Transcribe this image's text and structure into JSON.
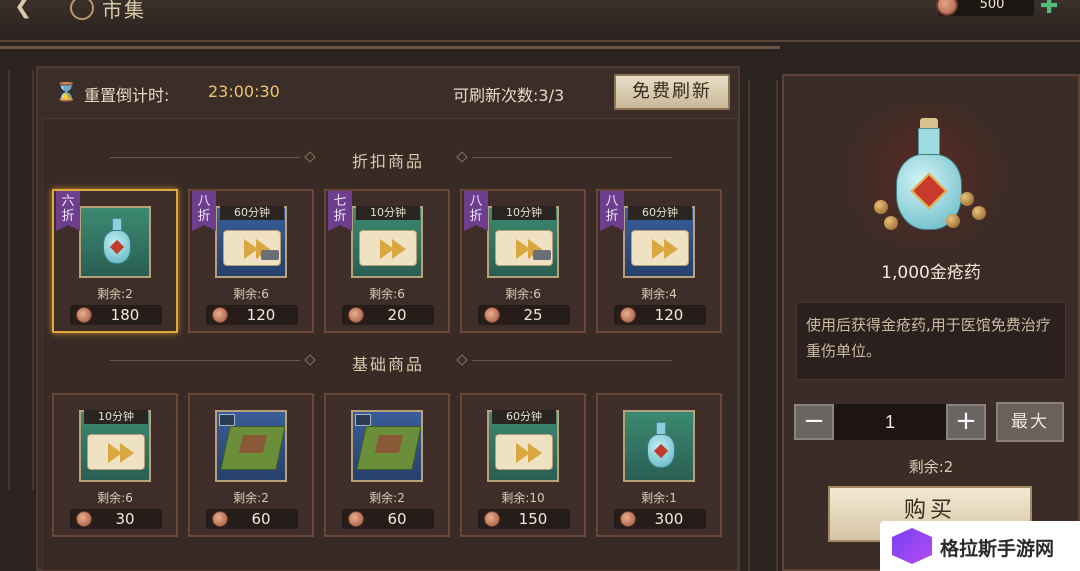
{
  "header": {
    "title": "市集",
    "coin_amount": "500"
  },
  "shop": {
    "timer_label": "重置倒计时:",
    "timer_value": "23:00:30",
    "refresh_label": "可刷新次数:3/3",
    "refresh_button": "免费刷新"
  },
  "sections": {
    "discount_title": "折扣商品",
    "basic_title": "基础商品"
  },
  "discount_items": [
    {
      "discount": "六折",
      "timer": "",
      "icon": "bottle-icon",
      "stock": "剩余:2",
      "price": "180"
    },
    {
      "discount": "八折",
      "timer": "60分钟",
      "icon": "scroll-hammer-icon",
      "stock": "剩余:6",
      "price": "120"
    },
    {
      "discount": "七折",
      "timer": "10分钟",
      "icon": "scroll-icon",
      "stock": "剩余:6",
      "price": "20"
    },
    {
      "discount": "八折",
      "timer": "10分钟",
      "icon": "scroll-hammer-icon",
      "stock": "剩余:6",
      "price": "25"
    },
    {
      "discount": "八折",
      "timer": "60分钟",
      "icon": "scroll-icon",
      "stock": "剩余:4",
      "price": "120"
    }
  ],
  "basic_items": [
    {
      "timer": "10分钟",
      "icon": "scroll-icon",
      "stock": "剩余:6",
      "price": "30"
    },
    {
      "timer": "",
      "icon": "land-tile-icon",
      "stock": "剩余:2",
      "price": "60"
    },
    {
      "timer": "",
      "icon": "farm-tile-icon",
      "stock": "剩余:2",
      "price": "60"
    },
    {
      "timer": "60分钟",
      "icon": "scroll-icon",
      "stock": "剩余:10",
      "price": "150"
    },
    {
      "timer": "",
      "icon": "bottle-icon",
      "stock": "剩余:1",
      "price": "300"
    }
  ],
  "detail": {
    "item_name": "1,000金疮药",
    "description": "使用后获得金疮药,用于医馆免费治疗重伤单位。",
    "quantity": "1",
    "minus": "−",
    "plus": "+",
    "max_button": "最大",
    "stock": "剩余:2",
    "buy_button": "购买"
  },
  "watermark": "格拉斯手游网",
  "colors": {
    "accent_gold": "#f0c36a",
    "selected_border": "#e0a93c",
    "discount_badge": "#6e3f8f"
  }
}
